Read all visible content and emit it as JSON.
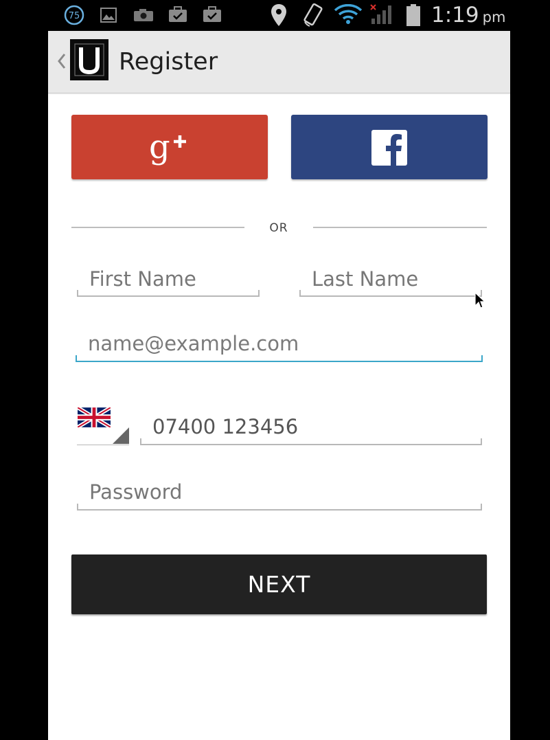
{
  "status_bar": {
    "notification_badge": "75",
    "time": "1:19",
    "ampm": "pm",
    "icons": [
      "notification-count-icon",
      "image-icon",
      "camera-icon",
      "briefcase-check-icon",
      "briefcase-check-icon",
      "location-pin-icon",
      "screen-rotation-icon",
      "wifi-icon",
      "signal-no-data-icon",
      "battery-icon"
    ]
  },
  "action_bar": {
    "title": "Register",
    "back_icon": "chevron-left-icon",
    "logo_icon": "uber-logo-icon"
  },
  "social": {
    "google_icon": "google-plus-icon",
    "google_color": "#c94130",
    "facebook_icon": "facebook-icon",
    "facebook_color": "#2d4580"
  },
  "divider": {
    "label": "OR"
  },
  "form": {
    "first_name": {
      "placeholder": "First Name"
    },
    "last_name": {
      "placeholder": "Last Name"
    },
    "email": {
      "placeholder": "name@example.com",
      "focus_color": "#3aa6c9"
    },
    "phone": {
      "country_icon": "uk-flag-icon",
      "value": "07400 123456"
    },
    "password": {
      "placeholder": "Password"
    }
  },
  "next_button": {
    "label": "NEXT"
  }
}
